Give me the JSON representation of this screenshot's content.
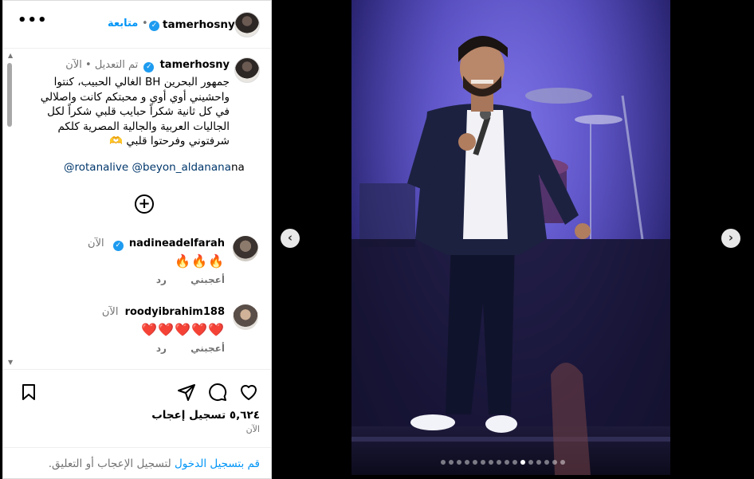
{
  "post": {
    "author": "tamerhosny",
    "follow_label": "متابعة",
    "more_label": "•••"
  },
  "caption": {
    "author": "tamerhosny",
    "edited": "تم التعديل",
    "time": "الآن",
    "text": "جمهور البحرين BH الغالي الحبيب، كنتوا واحشيني أوي أوي و محبتكم كانت واصلالي في كل ثانية شكراً حبايب قلبي شكراً لكل الجاليات العربية والجالية المصرية كلكم شرفتوني وفرحتوا قلبي 🫶",
    "mention_1": "@rotanalive",
    "mention_2": "@beyon_aldanana",
    "mention_suffix": "na"
  },
  "comments": [
    {
      "user": "nadineadelfarah",
      "time": "الآن",
      "text": "🔥🔥🔥",
      "like": "أعجبني",
      "reply": "رد"
    },
    {
      "user": "roodyibrahim188",
      "time": "الآن",
      "text": "❤️❤️❤️❤️❤️",
      "like": "أعجبني",
      "reply": "رد"
    }
  ],
  "stats": {
    "likes": "٥,٦٢٤ تسجيل إعجاب",
    "time": "الآن"
  },
  "login": {
    "link": "قم بتسجيل الدخول",
    "rest": " لتسجيل الإعجاب أو التعليق."
  },
  "carousel": {
    "prev": "‹",
    "next": "›",
    "total": 16,
    "active": 10
  },
  "icons": {
    "save": "bookmark-icon",
    "share": "send-icon",
    "comment": "comment-icon",
    "like": "heart-icon",
    "add": "add-circle-icon"
  }
}
